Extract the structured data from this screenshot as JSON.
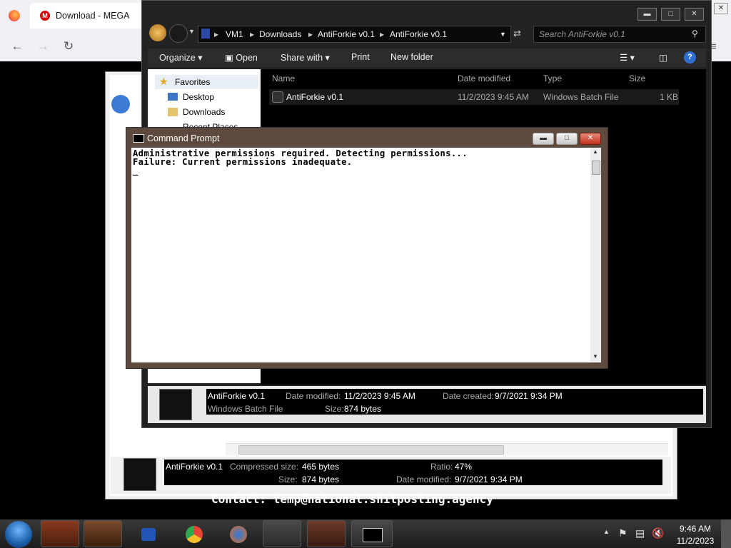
{
  "browser": {
    "tab_title": "Download - MEGA",
    "page_contact": "Contact: temp@national.shitposting.agency"
  },
  "explorer": {
    "breadcrumb": [
      "VM1",
      "Downloads",
      "AntiForkie v0.1",
      "AntiForkie v0.1"
    ],
    "search_placeholder": "Search AntiForkie v0.1",
    "toolbar": {
      "organize": "Organize",
      "open": "Open",
      "share_with": "Share with",
      "print": "Print",
      "new_folder": "New folder"
    },
    "nav": {
      "favorites": "Favorites",
      "desktop": "Desktop",
      "downloads": "Downloads",
      "recent": "Recent Places"
    },
    "columns": {
      "name": "Name",
      "date_modified": "Date modified",
      "type": "Type",
      "size": "Size"
    },
    "file": {
      "name": "AntiForkie v0.1",
      "date_modified": "11/2/2023 9:45 AM",
      "type": "Windows Batch File",
      "size": "1 KB"
    },
    "details": {
      "name": "AntiForkie v0.1",
      "type": "Windows Batch File",
      "date_modified_label": "Date modified:",
      "date_modified": "11/2/2023 9:45 AM",
      "date_created_label": "Date created:",
      "date_created": "9/7/2021 9:34 PM",
      "size_label": "Size:",
      "size": "874 bytes"
    }
  },
  "zipwin": {
    "details": {
      "name": "AntiForkie v0.1",
      "compressed_label": "Compressed size:",
      "compressed": "465 bytes",
      "ratio_label": "Ratio:",
      "ratio": "47%",
      "size_label": "Size:",
      "size": "874 bytes",
      "date_modified_label": "Date modified:",
      "date_modified": "9/7/2021 9:34 PM"
    }
  },
  "cmd": {
    "title": "Command Prompt",
    "lines": [
      "Administrative permissions required. Detecting permissions...",
      "Failure: Current permissions inadequate.",
      "_"
    ]
  },
  "taskbar": {
    "time": "9:46 AM",
    "date": "11/2/2023"
  },
  "colors": {
    "cmd_frame": "#5c4a3e",
    "explorer_frame": "#222222",
    "taskbar": "#2a2a2a"
  }
}
